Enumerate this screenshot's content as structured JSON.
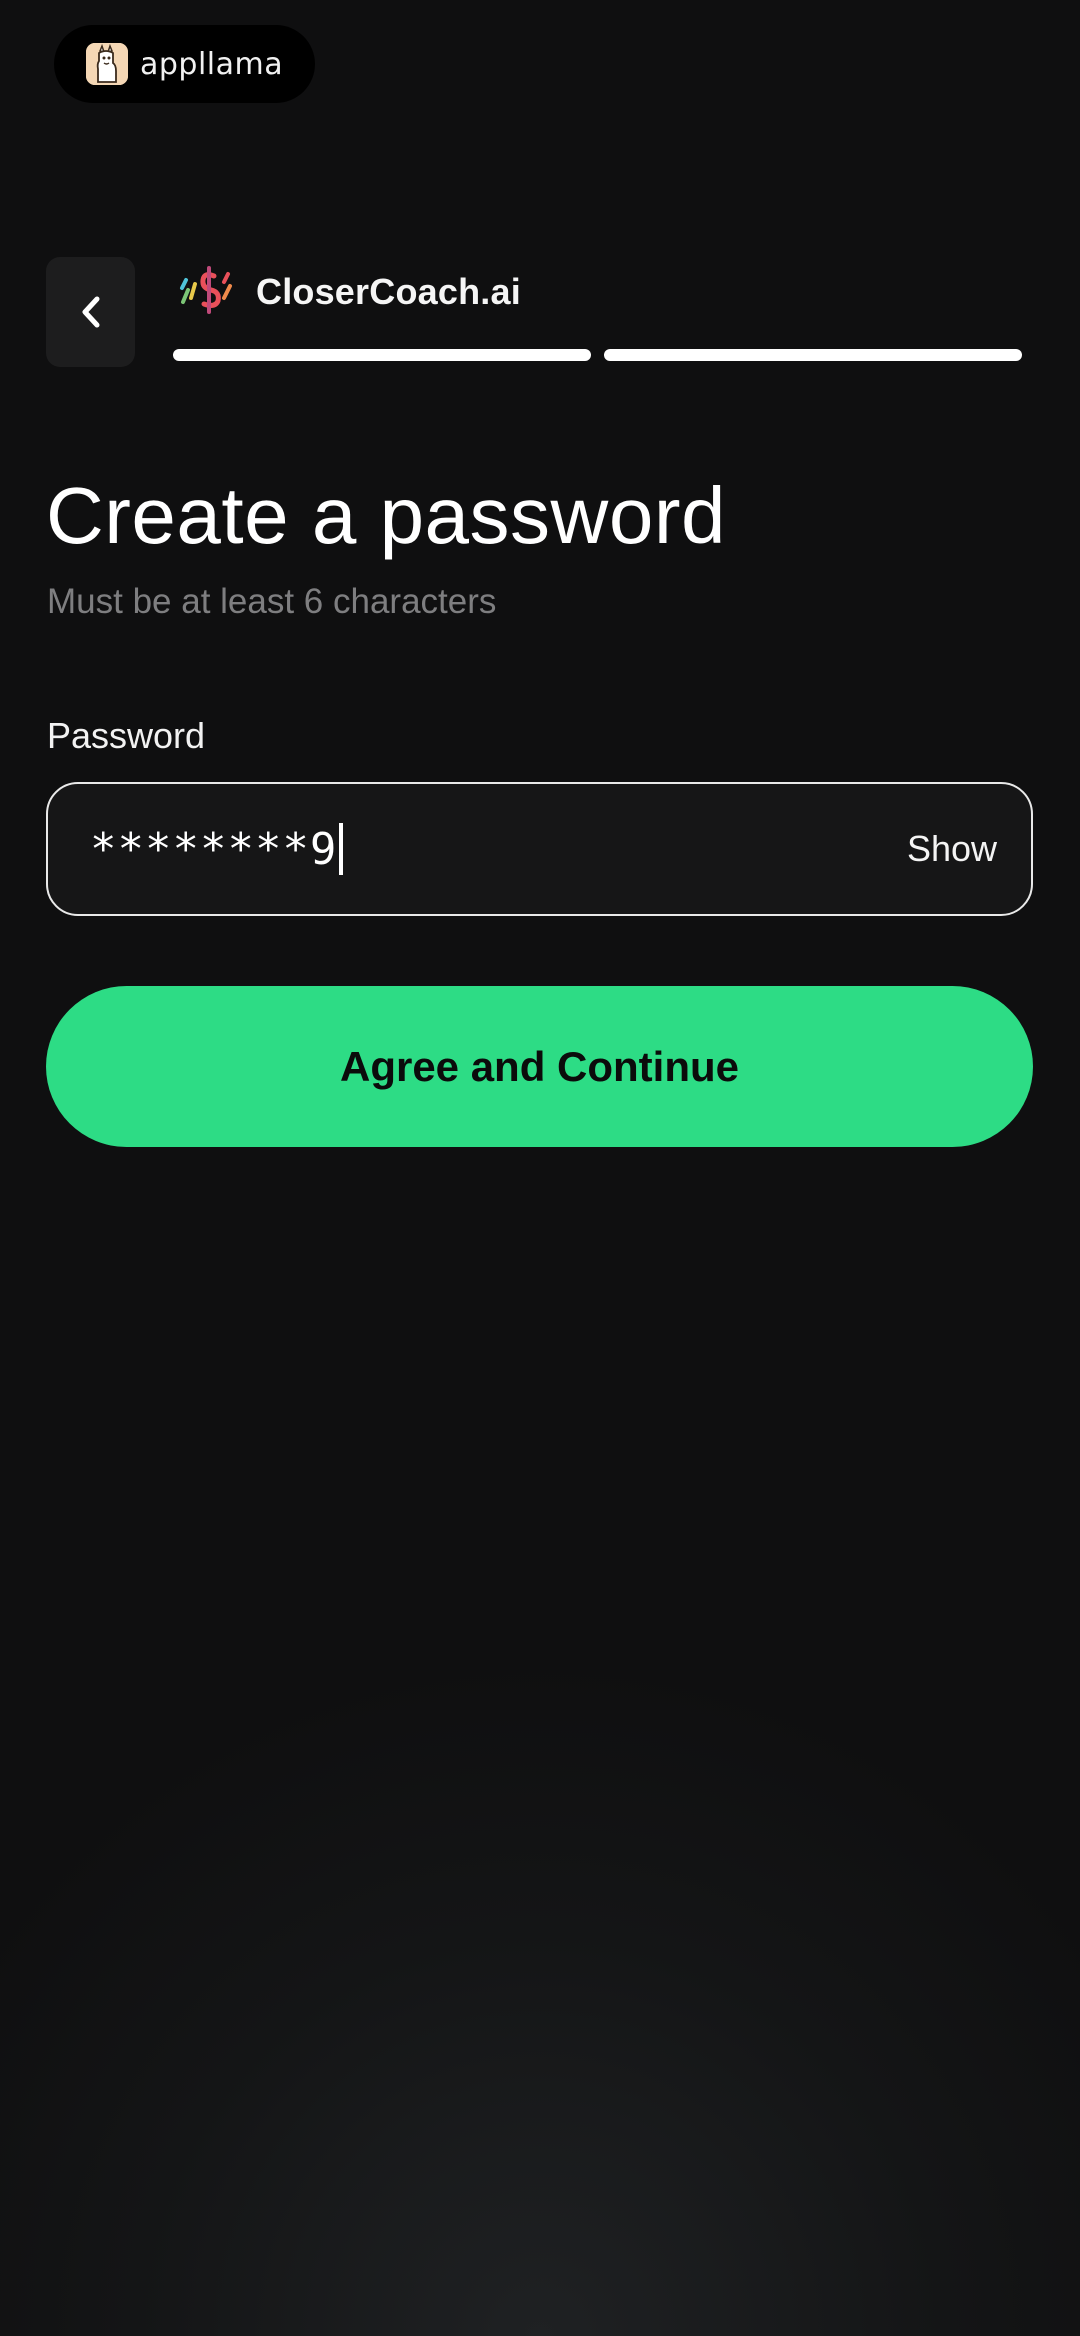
{
  "brand": {
    "name": "appllama",
    "logo_icon": "llama-icon",
    "pill_color": "#000000"
  },
  "header": {
    "back_icon": "chevron-left-icon",
    "app_logo_icon": "dollar-sign-logo-icon",
    "app_title": "CloserCoach.ai",
    "progress_steps_total": 2,
    "progress_steps_done": 2
  },
  "page": {
    "title": "Create a password",
    "subtitle": "Must be at least 6 characters"
  },
  "password_field": {
    "label": "Password",
    "value": "********9",
    "toggle_label": "Show"
  },
  "actions": {
    "continue_label": "Agree and Continue",
    "continue_color": "#2ddc85"
  }
}
